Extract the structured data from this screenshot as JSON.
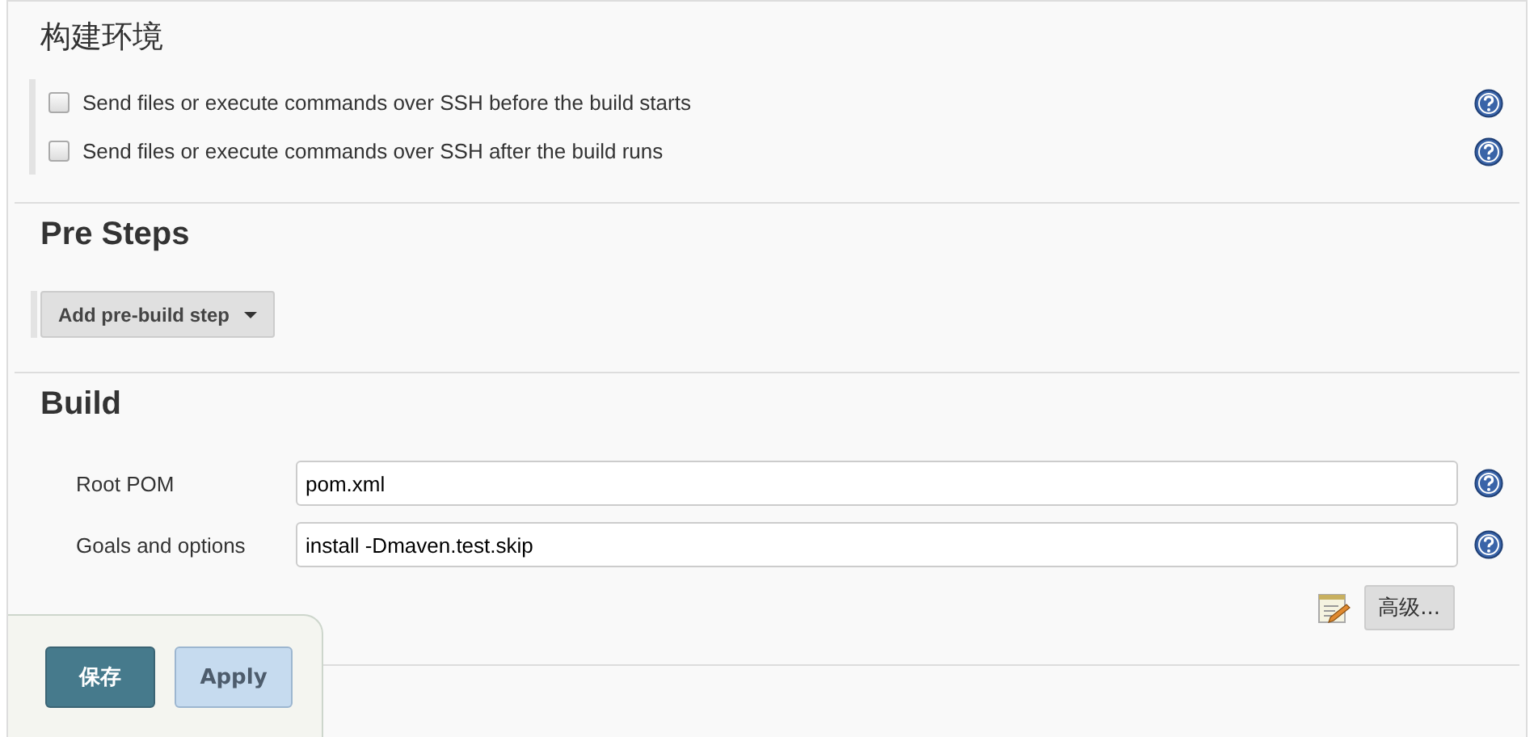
{
  "build_environment": {
    "title": "构建环境",
    "options": [
      {
        "label": "Send files or execute commands over SSH before the build starts",
        "checked": false
      },
      {
        "label": "Send files or execute commands over SSH after the build runs",
        "checked": false
      }
    ]
  },
  "pre_steps": {
    "title": "Pre Steps",
    "add_button": "Add pre-build step"
  },
  "build": {
    "title": "Build",
    "fields": [
      {
        "label": "Root POM",
        "value": "pom.xml"
      },
      {
        "label": "Goals and options",
        "value": "install -Dmaven.test.skip"
      }
    ],
    "advanced_button": "高级..."
  },
  "save_bar": {
    "buttons": [
      {
        "label": "保存",
        "kind": "primary"
      },
      {
        "label": "Apply",
        "kind": "secondary"
      }
    ]
  }
}
